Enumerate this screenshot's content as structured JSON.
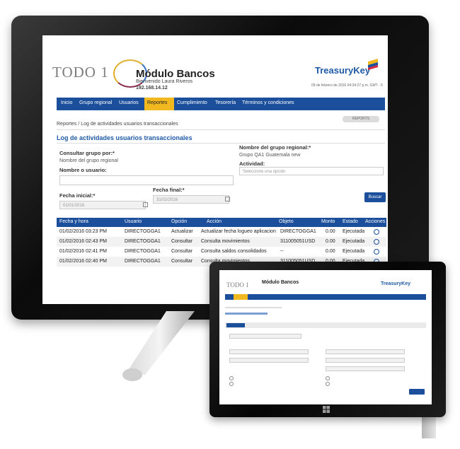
{
  "monitor": {
    "brand": {
      "todo": "TODO 1",
      "module_title": "Módulo Bancos",
      "welcome": "Bienvenido Laura Riveros",
      "ip": "192.168.14.12",
      "treasury": "TreasuryKey",
      "date": "09 de febrero de 2016 04:34:27 p.m. GMT - 5"
    },
    "nav": [
      "Inicio",
      "Grupo regional",
      "Usuarios",
      "Reportes",
      "Cumplimiento",
      "Tesorería",
      "Términos y condiciones"
    ],
    "breadcrumb": "Reportes / Log de actividades usuarios transaccionales",
    "crumb_tools": "REPORTS",
    "page_title": "Log de actividades usuarios transaccionales",
    "form": {
      "consultar_label": "Consultar grupo por:*",
      "consultar_value": "Nombre del grupo regional",
      "usuario_label": "Nombre o usuario:",
      "grupo_label": "Nombre del grupo regional:*",
      "grupo_value": "Grupo QA1 Guatemala new",
      "actividad_label": "Actividad:",
      "actividad_placeholder": "Seleccione una opción",
      "fecha_inicial_label": "Fecha inicial:*",
      "fecha_inicial_value": "01/01/2016",
      "fecha_final_label": "Fecha final:*",
      "fecha_final_value": "31/02/2016",
      "buscar": "Buscar"
    },
    "table": {
      "headers": [
        "Fecha y hora",
        "Usuario",
        "Opción",
        "Acción",
        "Objeto",
        "Monto",
        "Estado",
        "Acciones"
      ],
      "rows": [
        [
          "01/02/2016 03:23 PM",
          "DIRECTOGGA1",
          "Actualizar",
          "Actualizar fecha logueo aplicacion",
          "DIRECTOGGA1",
          "0.00",
          "Ejecutada"
        ],
        [
          "01/02/2016 02:43 PM",
          "DIRECTOGGA1",
          "Consultar",
          "Consulta movimientos",
          "311005051USD",
          "0.00",
          "Ejecutada"
        ],
        [
          "01/02/2016 02:41 PM",
          "DIRECTOGGA1",
          "Consultar",
          "Consulta saldos consolidados",
          "--",
          "0.00",
          "Ejecutada"
        ],
        [
          "01/02/2016 02:40 PM",
          "DIRECTOGGA1",
          "Consultar",
          "Consulta movimientos",
          "311005051USD",
          "0.00",
          "Ejecutada"
        ]
      ]
    }
  },
  "tablet": {
    "todo": "TODO 1",
    "module_title": "Módulo Bancos",
    "treasury": "TreasuryKey",
    "windows_logo": "windows-logo"
  },
  "colors": {
    "nav": "#1b4f9c",
    "accent": "#f2b820",
    "title": "#1f5aa6"
  }
}
